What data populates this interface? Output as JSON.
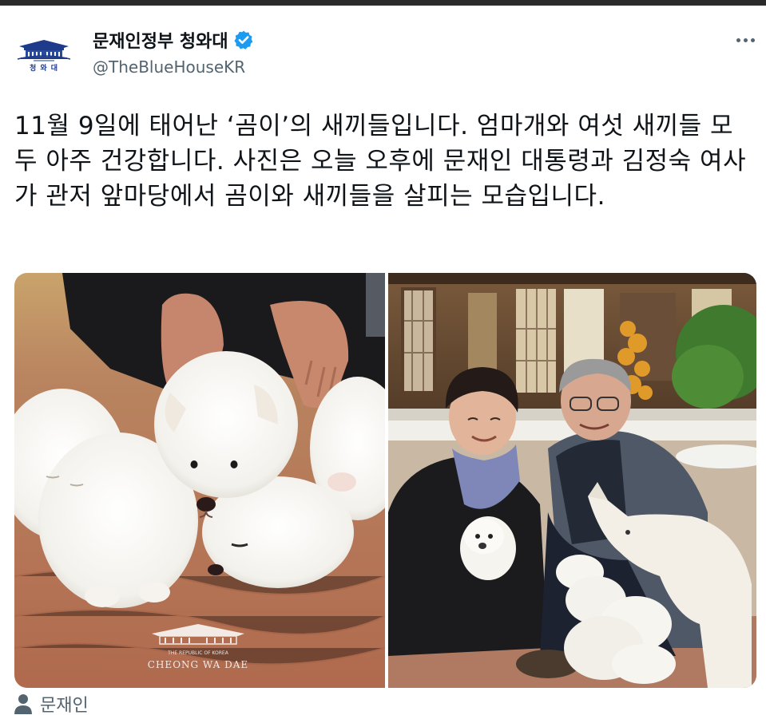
{
  "account": {
    "display_name": "문재인정부 청와대",
    "handle": "@TheBlueHouseKR",
    "verified": true,
    "avatar_caption": "청 와 대"
  },
  "tweet": {
    "text": "11월 9일에 태어난 ‘곰이’의 새끼들입니다. 엄마개와 여섯 새끼들 모두 아주 건강합니다. 사진은 오늘 오후에 문재인 대통령과 김정숙 여사가 관저 앞마당에서 곰이와 새끼들을 살피는 모습입니다."
  },
  "media": {
    "left_watermark_small": "THE REPUBLIC OF KOREA",
    "left_watermark": "CHEONG WA DAE"
  },
  "tagged": {
    "name": "문재인"
  },
  "icons": {
    "verified": "verified-badge-icon",
    "more": "more-dots-icon",
    "tag": "person-icon"
  },
  "colors": {
    "verified": "#1d9bf0",
    "secondary_text": "#536471",
    "topbar": "#2b2b2b"
  }
}
